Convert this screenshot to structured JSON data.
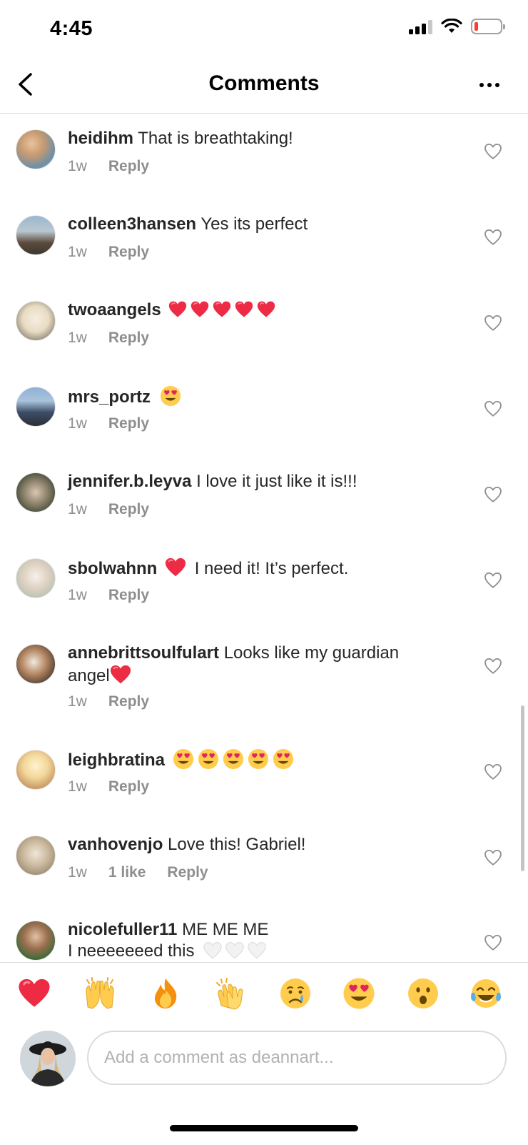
{
  "status": {
    "time": "4:45"
  },
  "header": {
    "title": "Comments",
    "back_icon": "chevron-left-icon",
    "more_icon": "more-horizontal-icon"
  },
  "comments": [
    {
      "user": "heidihm",
      "text": "That is breathtaking!",
      "emoji_after": "",
      "emoji_count": 0,
      "time": "1w",
      "likes": "",
      "reply": "Reply"
    },
    {
      "user": "colleen3hansen",
      "text": "Yes its perfect",
      "emoji_after": "",
      "emoji_count": 0,
      "time": "1w",
      "likes": "",
      "reply": "Reply"
    },
    {
      "user": "twoaangels",
      "text": "",
      "emoji_after": "red-heart",
      "emoji_count": 5,
      "time": "1w",
      "likes": "",
      "reply": "Reply"
    },
    {
      "user": "mrs_portz",
      "text": "",
      "emoji_after": "heart-eyes",
      "emoji_count": 1,
      "time": "1w",
      "likes": "",
      "reply": "Reply"
    },
    {
      "user": "jennifer.b.leyva",
      "text": "I love it just like it is!!!",
      "emoji_after": "",
      "emoji_count": 0,
      "time": "1w",
      "likes": "",
      "reply": "Reply"
    },
    {
      "user": "sbolwahnn",
      "text_before_emoji": "",
      "text": "I need it!  It’s perfect.",
      "emoji_inline": "red-heart",
      "time": "1w",
      "likes": "",
      "reply": "Reply"
    },
    {
      "user": "annebrittsoulfulart",
      "text": "Looks like my guardian angel",
      "emoji_after": "red-heart",
      "emoji_count": 1,
      "time": "1w",
      "likes": "",
      "reply": "Reply"
    },
    {
      "user": "leighbratina",
      "text": "",
      "emoji_after": "heart-eyes",
      "emoji_count": 5,
      "time": "1w",
      "likes": "",
      "reply": "Reply"
    },
    {
      "user": "vanhovenjo",
      "text": "Love this! Gabriel!",
      "emoji_after": "",
      "emoji_count": 0,
      "time": "1w",
      "likes": "1 like",
      "reply": "Reply"
    },
    {
      "user": "nicolefuller11",
      "text": "ME ME ME",
      "text_line2": "I neeeeeeed this",
      "emoji_after": "white-heart",
      "emoji_count": 3,
      "time": "",
      "likes": "",
      "reply": ""
    }
  ],
  "quick_emojis": [
    "red-heart",
    "raising-hands",
    "fire",
    "clapping-hands",
    "crying-face",
    "heart-eyes",
    "astonished-face",
    "tears-of-joy"
  ],
  "composer": {
    "placeholder": "Add a comment as deannart..."
  },
  "colors": {
    "text": "#262626",
    "meta": "#8e8e8e",
    "divider": "#dbdbdb",
    "heart_red": "#ed2b45",
    "emoji_yellow": "#ffcc4d"
  }
}
